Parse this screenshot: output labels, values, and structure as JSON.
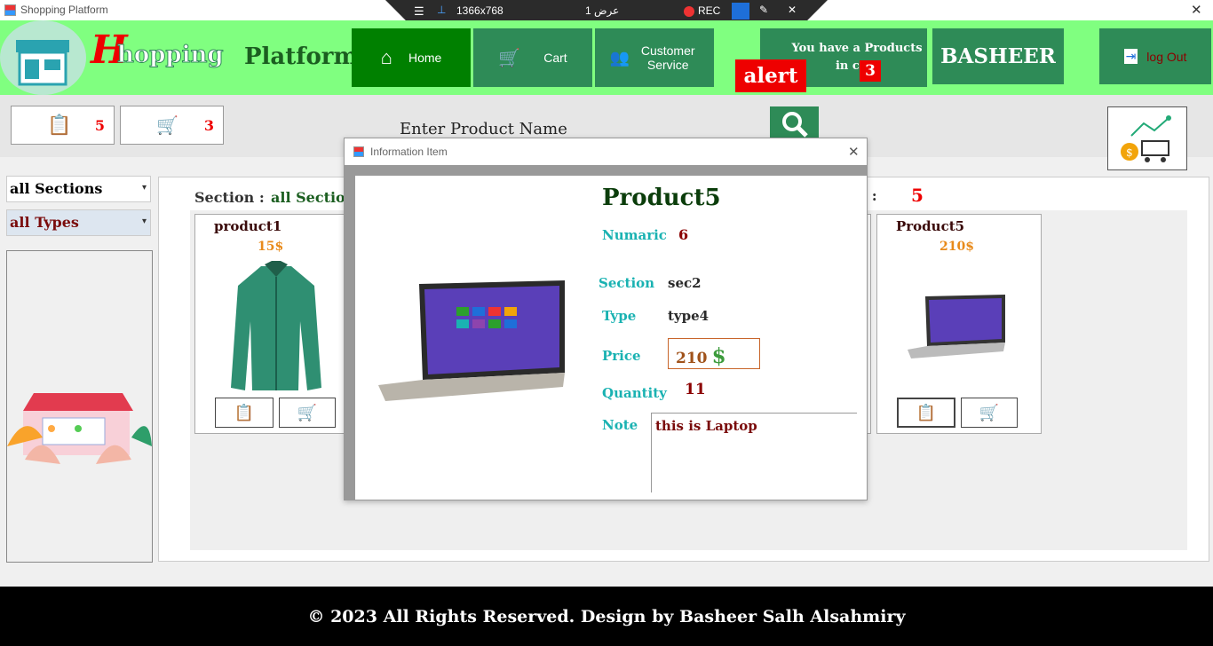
{
  "window": {
    "title": "Shopping Platform",
    "close": "✕"
  },
  "recorder": {
    "resolution": "1366x768",
    "display": "عرض 1",
    "rec": "REC"
  },
  "header": {
    "logo_h": "H",
    "logo_rest": "hopping",
    "logo_platform": "Platform",
    "nav": [
      {
        "label": "Home"
      },
      {
        "label": "Cart"
      },
      {
        "label": "Customer Service"
      }
    ],
    "cart_notice": "You have a Products in cart",
    "cart_count": "3",
    "alert": "alert",
    "user": "BASHEER",
    "logout": "log Out"
  },
  "counters": {
    "list_count": "5",
    "cart_count": "3"
  },
  "search": {
    "placeholder": "Enter Product Name"
  },
  "filters": {
    "section": "all Sections",
    "type": "all Types"
  },
  "main": {
    "section_label": "Section :",
    "section_value": "all Section",
    "product_label": "ct :",
    "product_value": "5"
  },
  "cards": [
    {
      "name": "product1",
      "price": "15$"
    },
    {
      "name": "Product5",
      "price": "210$"
    }
  ],
  "dialog": {
    "title": "Information Item",
    "close": "✕",
    "name": "Product5",
    "numaric_label": "Numaric",
    "numaric_value": "6",
    "section_label": "Section",
    "section_value": "sec2",
    "type_label": "Type",
    "type_value": "type4",
    "price_label": "Price",
    "price_value": "210",
    "price_currency": "$",
    "quantity_label": "Quantity",
    "quantity_value": "11",
    "note_label": "Note",
    "note_value": "this is Laptop"
  },
  "footer": {
    "text": "© 2023 All Rights Reserved. Design by Basheer Salh Alsahmiry"
  },
  "colors": {
    "header_green": "#80ff80",
    "button_green": "#2e8b57",
    "home_green": "#008000",
    "alert_red": "#ff0000",
    "price_orange": "#e88a1a",
    "label_teal": "#1ab2b2"
  }
}
